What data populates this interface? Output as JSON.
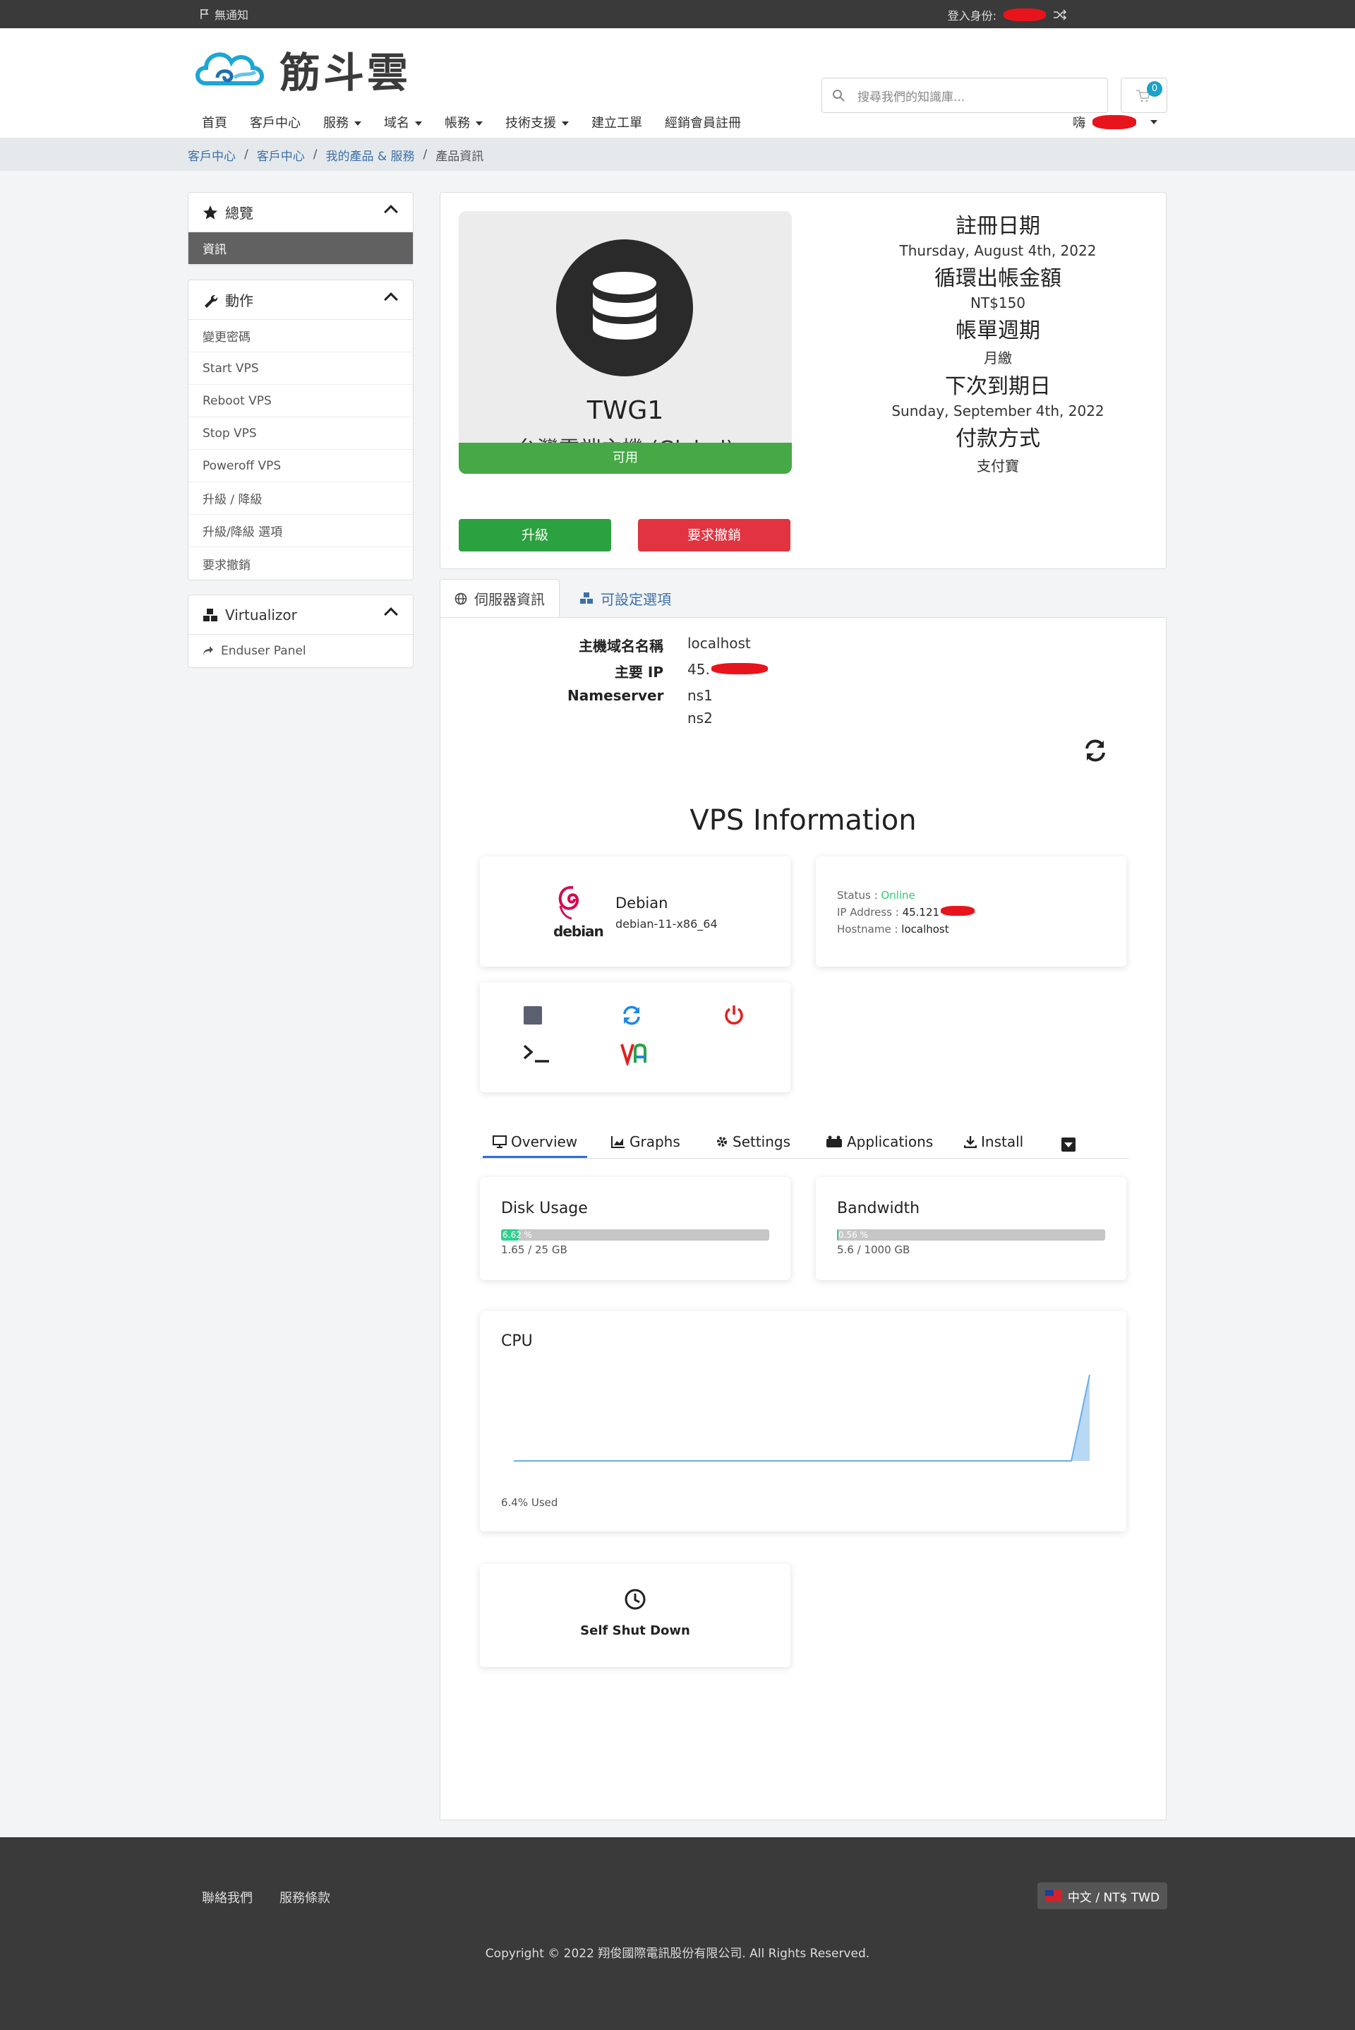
{
  "topbar": {
    "notice": "無通知",
    "login_label": "登入身份:"
  },
  "header": {
    "brand": "筋斗雲",
    "search_placeholder": "搜尋我們的知識庫...",
    "cart_count": "0",
    "greeting": "嗨"
  },
  "nav": {
    "items": [
      "首頁",
      "客戶中心",
      "服務",
      "域名",
      "帳務",
      "技術支援",
      "建立工單",
      "經銷會員註冊"
    ]
  },
  "breadcrumb": [
    "客戶中心",
    "客戶中心",
    "我的產品 & 服務",
    "產品資訊"
  ],
  "sidebar": {
    "overview": {
      "title": "總覽",
      "items": [
        "資訊"
      ]
    },
    "actions": {
      "title": "動作",
      "items": [
        "變更密碼",
        "Start VPS",
        "Reboot VPS",
        "Stop VPS",
        "Poweroff VPS",
        "升級 / 降級",
        "升級/降級 選項",
        "要求撤銷"
      ]
    },
    "virtualizor": {
      "title": "Virtualizor",
      "items": [
        "Enduser Panel"
      ]
    }
  },
  "product": {
    "name": "TWG1",
    "group": "台灣雲端主機 (Global)",
    "status": "可用",
    "upgrade_btn": "升級",
    "cancel_btn": "要求撤銷"
  },
  "details": {
    "reg_label": "註冊日期",
    "reg_value": "Thursday, August 4th, 2022",
    "amount_label": "循環出帳金額",
    "amount_value": "NT$150",
    "cycle_label": "帳單週期",
    "cycle_value": "月繳",
    "due_label": "下次到期日",
    "due_value": "Sunday, September 4th, 2022",
    "pay_label": "付款方式",
    "pay_value": "支付寶"
  },
  "tabs": {
    "server_info": "伺服器資訊",
    "config": "可設定選項"
  },
  "server": {
    "host_label": "主機域名名稱",
    "host_value": "localhost",
    "ip_label": "主要 IP",
    "ip_value": "45.",
    "ns_label": "Nameserver",
    "ns1": "ns1",
    "ns2": "ns2"
  },
  "vps": {
    "title": "VPS Information",
    "os_name": "Debian",
    "os_version": "debian-11-x86_64",
    "os_logo_text": "debian",
    "status_label": "Status :",
    "status_value": "Online",
    "ip_label": "IP Address :",
    "ip_value": "45.121",
    "host_label": "Hostname :",
    "host_value": "localhost",
    "tabs": [
      "Overview",
      "Graphs",
      "Settings",
      "Applications",
      "Install"
    ],
    "disk_title": "Disk Usage",
    "disk_pct": 6.62,
    "disk_pct_label": "6.62 %",
    "disk_text": "1.65 / 25 GB",
    "bw_title": "Bandwidth",
    "bw_pct": 0.56,
    "bw_pct_label": "0.56 %",
    "bw_text": "5.6 / 1000 GB",
    "cpu_title": "CPU",
    "cpu_used": "6.4% Used",
    "shutdown": "Self Shut Down",
    "colors": {
      "online": "#2ecc71",
      "disk": "#2fd08f",
      "stop": "#5b5f70",
      "restart": "#1e88e5",
      "power": "#e0201f"
    }
  },
  "footer": {
    "links": [
      "聯絡我們",
      "服務條款"
    ],
    "language": "中文 / NT$ TWD",
    "copyright": "Copyright © 2022 翔俊國際電訊股份有限公司. All Rights Reserved."
  }
}
